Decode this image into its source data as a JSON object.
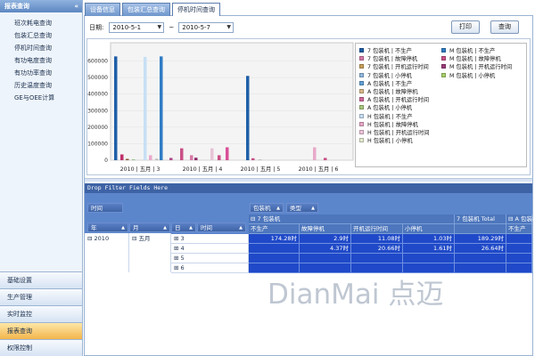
{
  "sidebar": {
    "title": "报表查询",
    "collapse": "«",
    "items": [
      "班次耗电查询",
      "包装汇总查询",
      "停机时间查询",
      "有功电度查询",
      "有功功率查询",
      "历史温度查询",
      "GE与OEE计算"
    ],
    "nav": [
      "基础设置",
      "生产管理",
      "实时监控",
      "报表查询",
      "权限控制"
    ],
    "active_nav": 3
  },
  "tabs": [
    "设备信息",
    "包装汇总查询",
    "停机时间查询"
  ],
  "active_tab": 2,
  "datebar": {
    "label": "日期:",
    "from": "2010-5-1",
    "tilde": "~",
    "to": "2010-5-7",
    "print": "打印",
    "query": "查询"
  },
  "chart_data": {
    "type": "bar",
    "ylim": [
      0,
      700000
    ],
    "yticks": [
      "600000",
      "500000",
      "400000",
      "300000",
      "200000",
      "100000",
      "0"
    ],
    "categories": [
      "2010 | 五月 | 3",
      "2010 | 五月 | 4",
      "2010 | 五月 | 5",
      "2010 | 五月 | 6"
    ],
    "bars": [
      {
        "cat": 0,
        "x": 128,
        "value": 628000,
        "color": "#1f5fa8"
      },
      {
        "cat": 0,
        "x": 135,
        "value": 35000,
        "color": "#c0306a"
      },
      {
        "cat": 0,
        "x": 141,
        "value": 8000,
        "color": "#8a5a3a"
      },
      {
        "cat": 0,
        "x": 148,
        "value": 3000,
        "color": "#4f9a3a"
      },
      {
        "cat": 0,
        "x": 161,
        "value": 625000,
        "color": "#c7dff5"
      },
      {
        "cat": 0,
        "x": 167,
        "value": 30000,
        "color": "#e8a9c9"
      },
      {
        "cat": 0,
        "x": 174,
        "value": 9000,
        "color": "#bfbfbf"
      },
      {
        "cat": 0,
        "x": 179,
        "value": 628000,
        "color": "#2f7cc4"
      },
      {
        "cat": 1,
        "x": 190,
        "value": 14000,
        "color": "#b04c8c"
      },
      {
        "cat": 1,
        "x": 202,
        "value": 72000,
        "color": "#c94f86"
      },
      {
        "cat": 1,
        "x": 213,
        "value": 30000,
        "color": "#d77aa8"
      },
      {
        "cat": 1,
        "x": 218,
        "value": 15000,
        "color": "#8c2a6a"
      },
      {
        "cat": 1,
        "x": 236,
        "value": 72000,
        "color": "#e7c3d6"
      },
      {
        "cat": 1,
        "x": 244,
        "value": 30000,
        "color": "#c94f86"
      },
      {
        "cat": 1,
        "x": 253,
        "value": 78000,
        "color": "#d94f96"
      },
      {
        "cat": 2,
        "x": 276,
        "value": 510000,
        "color": "#1f5fa8"
      },
      {
        "cat": 2,
        "x": 282,
        "value": 12000,
        "color": "#c94f86"
      },
      {
        "cat": 2,
        "x": 290,
        "value": 5000,
        "color": "#bfbfbf"
      },
      {
        "cat": 3,
        "x": 351,
        "value": 78000,
        "color": "#e8a9c9"
      },
      {
        "cat": 3,
        "x": 363,
        "value": 14000,
        "color": "#c94f86"
      }
    ]
  },
  "legend": {
    "col1": [
      {
        "label": "7 包装机 | 不生产",
        "color": "#1f5fa8"
      },
      {
        "label": "7 包装机 | 故障停机",
        "color": "#d77aa8"
      },
      {
        "label": "7 包装机 | 开机运行时间",
        "color": "#c9a05a"
      },
      {
        "label": "7 包装机 | 小停机",
        "color": "#8fb7df"
      },
      {
        "label": "A 包装机 | 不生产",
        "color": "#62a2d8"
      },
      {
        "label": "A 包装机 | 故障停机",
        "color": "#d9b98a"
      },
      {
        "label": "A 包装机 | 开机运行时间",
        "color": "#d06a9c"
      },
      {
        "label": "A 包装机 | 小停机",
        "color": "#a8c97e"
      },
      {
        "label": "H 包装机 | 不生产",
        "color": "#c7dff5"
      },
      {
        "label": "H 包装机 | 故障停机",
        "color": "#e8a9c9"
      },
      {
        "label": "H 包装机 | 开机运行时间",
        "color": "#f0c6dc"
      },
      {
        "label": "H 包装机 | 小停机",
        "color": "#e6ecd2"
      }
    ],
    "col2": [
      {
        "label": "M 包装机 | 不生产",
        "color": "#2f7cc4"
      },
      {
        "label": "M 包装机 | 故障停机",
        "color": "#c94f86"
      },
      {
        "label": "M 包装机 | 开机运行时间",
        "color": "#9c3d7a"
      },
      {
        "label": "M 包装机 | 小停机",
        "color": "#a8d06a"
      }
    ]
  },
  "pivot": {
    "drop_filter": "Drop Filter Fields Here",
    "fields": {
      "time": "时间",
      "packer": "包装机",
      "type": "类型"
    },
    "row_fields": {
      "year": "年",
      "month": "月",
      "day": "日",
      "time": "时间"
    },
    "col_header": "7 包装机",
    "total_header": "7 包装机 Total",
    "next_header": "A 包装机",
    "types": [
      "不生产",
      "故障停机",
      "开机运行时间",
      "小停机"
    ],
    "next_type": "不生产",
    "year": "2010",
    "month": "五月",
    "days": [
      "3",
      "4",
      "5",
      "6"
    ],
    "rows": [
      [
        "174.28时",
        "2.9时",
        "11.08时",
        "1.03时",
        "189.29时"
      ],
      [
        "",
        "4.37时",
        "20.66时",
        "1.61时",
        "26.64时"
      ],
      [
        "",
        "",
        "",
        "",
        ""
      ],
      [
        "",
        "",
        "",
        "",
        ""
      ]
    ]
  },
  "watermark": "DianMai 点迈"
}
